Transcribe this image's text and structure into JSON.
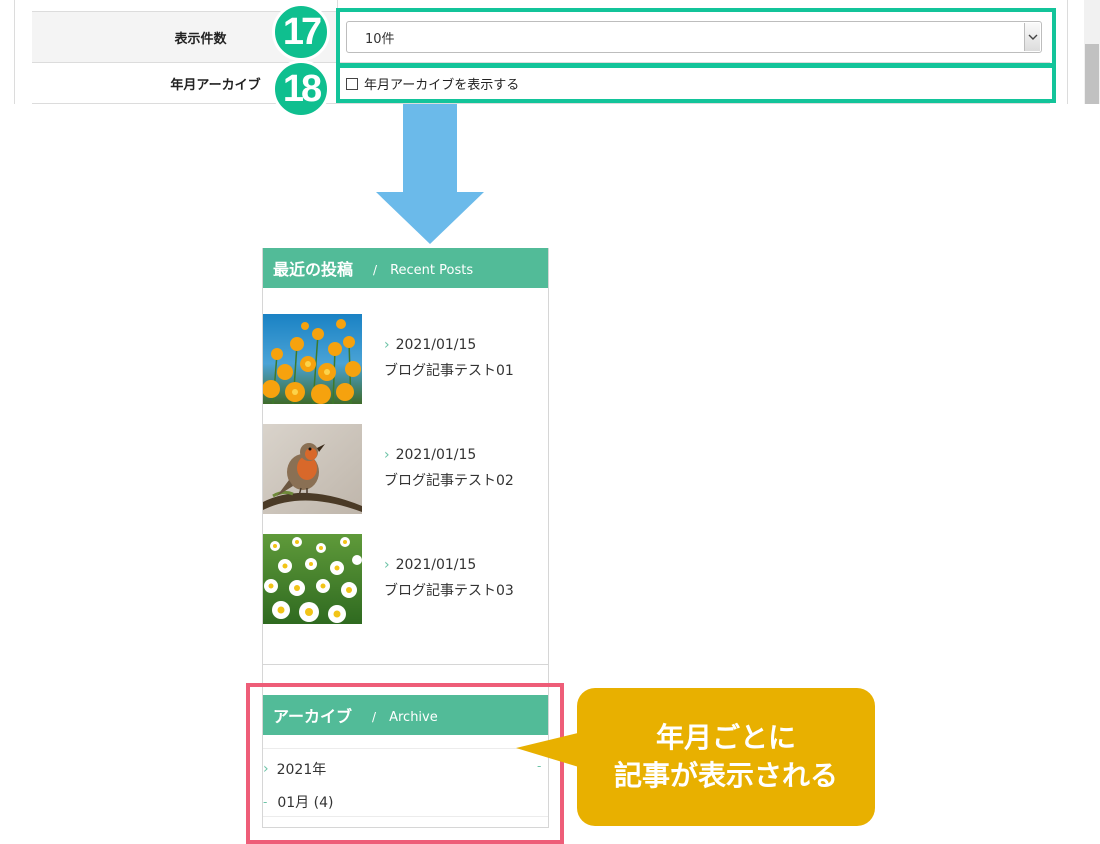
{
  "settings": {
    "rows": [
      {
        "label": "表示件数",
        "badge": "17",
        "select_value": "10件"
      },
      {
        "label": "年月アーカイブ",
        "badge": "18",
        "checkbox_label": "年月アーカイブを表示する",
        "checked": false
      }
    ]
  },
  "widget_recent": {
    "title_ja": "最近の投稿",
    "separator": "/",
    "title_en": "Recent Posts",
    "posts": [
      {
        "date": "2021/01/15",
        "title": "ブログ記事テスト01",
        "thumb": "orange-flowers"
      },
      {
        "date": "2021/01/15",
        "title": "ブログ記事テスト02",
        "thumb": "robin-bird"
      },
      {
        "date": "2021/01/15",
        "title": "ブログ記事テスト03",
        "thumb": "white-daisies"
      }
    ]
  },
  "widget_archive": {
    "title_ja": "アーカイブ",
    "separator": "/",
    "title_en": "Archive",
    "year_label": "2021年",
    "year_toggle": "-",
    "month_label": "01月 (4)"
  },
  "callout": {
    "line1": "年月ごとに",
    "line2": "記事が表示される"
  },
  "colors": {
    "teal_highlight": "#13c49a",
    "widget_green": "#52bb98",
    "pink_highlight": "#ee5d78",
    "callout_yellow": "#e8b000",
    "arrow_blue": "#6bbaea"
  }
}
